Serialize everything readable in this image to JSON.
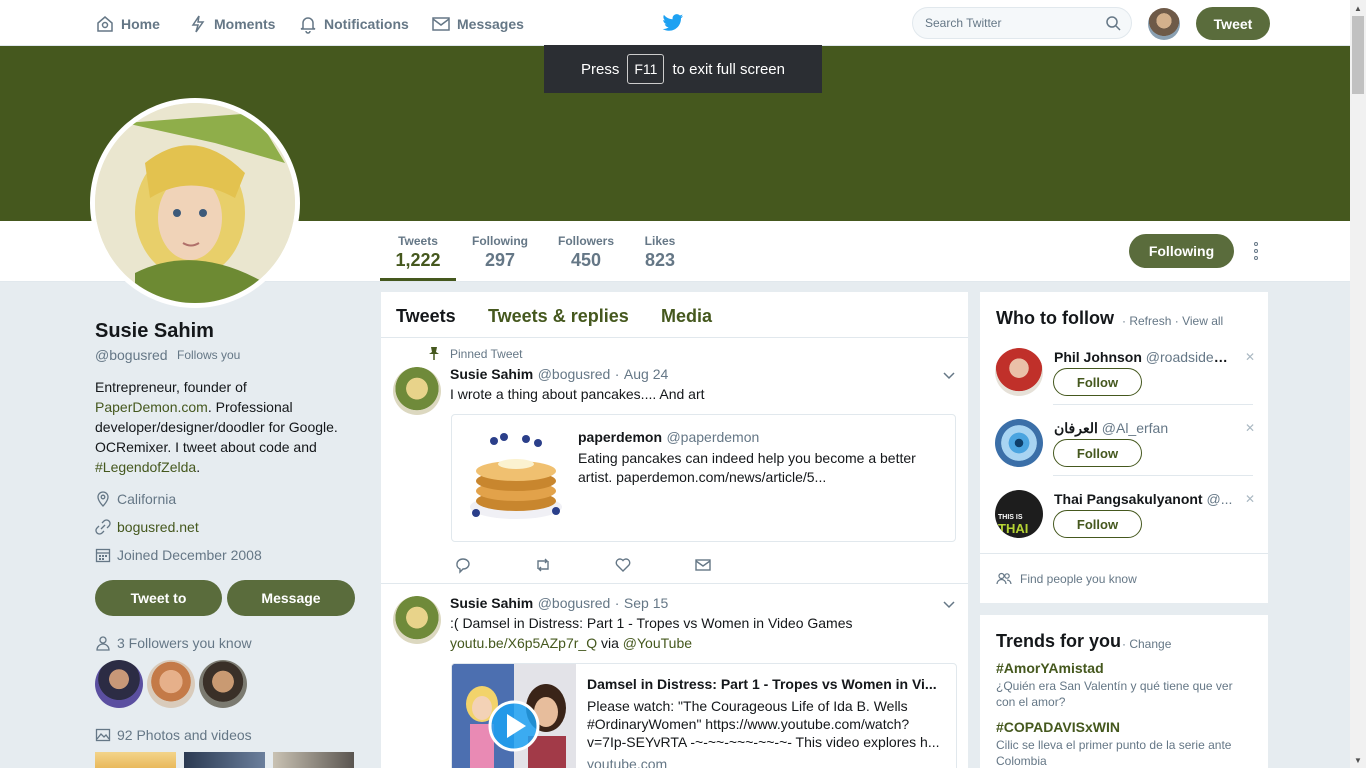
{
  "nav": {
    "home": "Home",
    "moments": "Moments",
    "notifications": "Notifications",
    "messages": "Messages",
    "search_placeholder": "Search Twitter",
    "tweet_button": "Tweet"
  },
  "fullscreen_notice": {
    "prefix": "Press",
    "key": "F11",
    "suffix": "to exit full screen"
  },
  "profile": {
    "name": "Susie Sahim",
    "handle": "@bogusred",
    "follows_you": "Follows you",
    "bio_line1": "Entrepreneur, founder of",
    "bio_link1": "PaperDemon.com",
    "bio_line2": ". Professional developer/designer/doodler for Google. OCRemixer. I tweet about code and",
    "bio_link2": "#LegendofZelda",
    "bio_end": ".",
    "location": "California",
    "website": "bogusred.net",
    "joined": "Joined December 2008",
    "tweet_to": "Tweet to",
    "message": "Message",
    "followers_you_know": "3 Followers you know",
    "photos_videos": "92 Photos and videos"
  },
  "stats": [
    {
      "label": "Tweets",
      "value": "1,222"
    },
    {
      "label": "Following",
      "value": "297"
    },
    {
      "label": "Followers",
      "value": "450"
    },
    {
      "label": "Likes",
      "value": "823"
    }
  ],
  "following_button": "Following",
  "tabs": [
    "Tweets",
    "Tweets & replies",
    "Media"
  ],
  "tweets": [
    {
      "pinned": "Pinned Tweet",
      "name": "Susie Sahim",
      "handle": "@bogusred",
      "sep": "·",
      "date": "Aug 24",
      "text": "I wrote a thing about pancakes.... And art",
      "card": {
        "name": "paperdemon",
        "handle": "@paperdemon",
        "text": "Eating pancakes can indeed help you become a better artist. paperdemon.com/news/article/5..."
      }
    },
    {
      "name": "Susie Sahim",
      "handle": "@bogusred",
      "sep": "·",
      "date": "Sep 15",
      "text": ":( Damsel in Distress: Part 1 - Tropes vs Women in Video Games",
      "link": "youtu.be/X6p5AZp7r_Q",
      "via": "via",
      "mention": "@YouTube",
      "card": {
        "title": "Damsel in Distress: Part 1 - Tropes vs Women in Vi...",
        "desc": "Please watch: \"The Courageous Life of Ida B. Wells #OrdinaryWomen\" https://www.youtube.com/watch?v=7Ip-SEYvRTA -~-~~-~~~-~~-~- This video explores h...",
        "domain": "youtube.com"
      }
    }
  ],
  "who_to_follow": {
    "title": "Who to follow",
    "refresh": "Refresh",
    "view_all": "View all",
    "sep": "·",
    "users": [
      {
        "name": "Phil Johnson",
        "handle": "@roadsidephil",
        "follow": "Follow"
      },
      {
        "name": "العرفان",
        "handle": "@Al_erfan",
        "follow": "Follow"
      },
      {
        "name": "Thai Pangsakulyanont",
        "handle": "@...",
        "follow": "Follow"
      }
    ],
    "find_people": "Find people you know",
    "avatar3_text1": "THIS IS",
    "avatar3_text2": "THAI"
  },
  "trends": {
    "title": "Trends for you",
    "change": "Change",
    "items": [
      {
        "tag": "#AmorYAmistad",
        "desc": "¿Quién era San Valentín y qué tiene que ver con el amor?"
      },
      {
        "tag": "#COPADAVISxWIN",
        "desc": "Cilic se lleva el primer punto de la serie ante Colombia"
      }
    ]
  },
  "colors": {
    "brand": "#45581e",
    "button": "#5a6c3c",
    "twitter_blue": "#1da1f2"
  }
}
